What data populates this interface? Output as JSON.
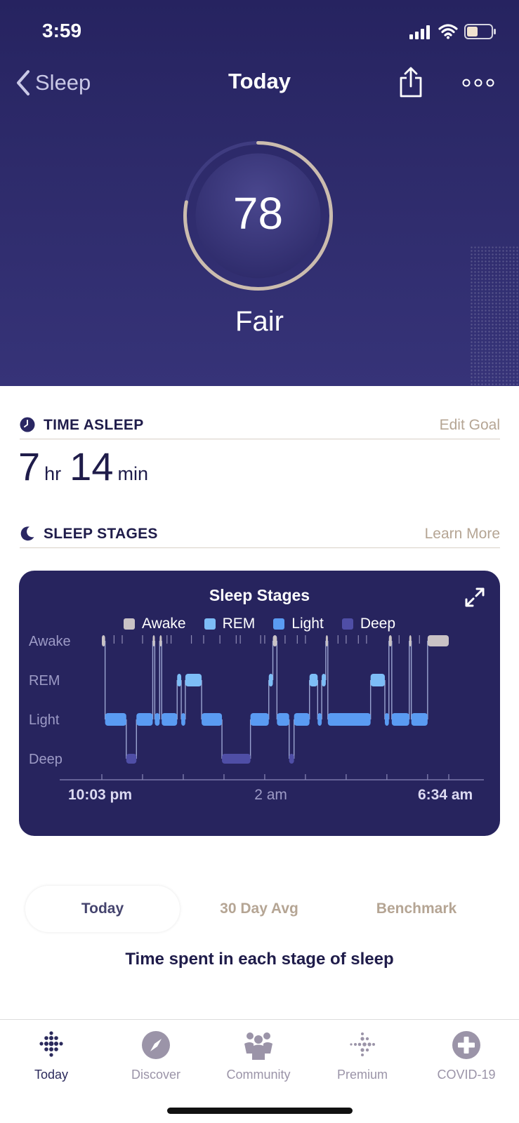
{
  "status": {
    "time": "3:59"
  },
  "nav": {
    "back_label": "Sleep",
    "title": "Today"
  },
  "score": {
    "value": "78",
    "label": "Fair",
    "fraction": 0.78
  },
  "time_asleep": {
    "title": "TIME ASLEEP",
    "edit_link": "Edit Goal",
    "hours": "7",
    "hours_unit": "hr",
    "minutes": "14",
    "minutes_unit": "min"
  },
  "sleep_stages": {
    "title": "SLEEP STAGES",
    "learn_link": "Learn More"
  },
  "chart_data": {
    "type": "area",
    "title": "Sleep Stages",
    "legend": [
      {
        "name": "Awake",
        "color": "#c9c2c5"
      },
      {
        "name": "REM",
        "color": "#7dbdf6"
      },
      {
        "name": "Light",
        "color": "#5a9bf2"
      },
      {
        "name": "Deep",
        "color": "#4f4ea6"
      }
    ],
    "y_categories": [
      "Awake",
      "REM",
      "Light",
      "Deep"
    ],
    "x_tick_labels": [
      "10:03 pm",
      "2 am",
      "6:34 am"
    ],
    "x_range": [
      "10:03 pm",
      "6:34 am"
    ],
    "stage_sequence": [
      {
        "stage": "Awake",
        "start_h": 0.0,
        "end_h": 0.08
      },
      {
        "stage": "Light",
        "start_h": 0.08,
        "end_h": 0.6
      },
      {
        "stage": "Deep",
        "start_h": 0.6,
        "end_h": 0.85
      },
      {
        "stage": "Light",
        "start_h": 0.85,
        "end_h": 1.25
      },
      {
        "stage": "Awake",
        "start_h": 1.25,
        "end_h": 1.3
      },
      {
        "stage": "Light",
        "start_h": 1.3,
        "end_h": 1.42
      },
      {
        "stage": "Awake",
        "start_h": 1.42,
        "end_h": 1.47
      },
      {
        "stage": "Light",
        "start_h": 1.47,
        "end_h": 1.85
      },
      {
        "stage": "REM",
        "start_h": 1.85,
        "end_h": 1.95
      },
      {
        "stage": "Light",
        "start_h": 1.95,
        "end_h": 2.05
      },
      {
        "stage": "REM",
        "start_h": 2.05,
        "end_h": 2.45
      },
      {
        "stage": "Light",
        "start_h": 2.45,
        "end_h": 2.95
      },
      {
        "stage": "Deep",
        "start_h": 2.95,
        "end_h": 3.65
      },
      {
        "stage": "Light",
        "start_h": 3.65,
        "end_h": 4.1
      },
      {
        "stage": "REM",
        "start_h": 4.1,
        "end_h": 4.2
      },
      {
        "stage": "Awake",
        "start_h": 4.2,
        "end_h": 4.3
      },
      {
        "stage": "Light",
        "start_h": 4.3,
        "end_h": 4.6
      },
      {
        "stage": "Deep",
        "start_h": 4.6,
        "end_h": 4.72
      },
      {
        "stage": "Light",
        "start_h": 4.72,
        "end_h": 5.1
      },
      {
        "stage": "REM",
        "start_h": 5.1,
        "end_h": 5.3
      },
      {
        "stage": "Light",
        "start_h": 5.3,
        "end_h": 5.4
      },
      {
        "stage": "REM",
        "start_h": 5.4,
        "end_h": 5.5
      },
      {
        "stage": "Awake",
        "start_h": 5.5,
        "end_h": 5.55
      },
      {
        "stage": "Light",
        "start_h": 5.55,
        "end_h": 6.6
      },
      {
        "stage": "REM",
        "start_h": 6.6,
        "end_h": 6.95
      },
      {
        "stage": "Light",
        "start_h": 6.95,
        "end_h": 7.05
      },
      {
        "stage": "Awake",
        "start_h": 7.05,
        "end_h": 7.12
      },
      {
        "stage": "Light",
        "start_h": 7.12,
        "end_h": 7.55
      },
      {
        "stage": "Awake",
        "start_h": 7.55,
        "end_h": 7.6
      },
      {
        "stage": "Light",
        "start_h": 7.6,
        "end_h": 8.0
      },
      {
        "stage": "Awake",
        "start_h": 8.0,
        "end_h": 8.52
      }
    ]
  },
  "tabs": {
    "items": [
      "Today",
      "30 Day Avg",
      "Benchmark"
    ],
    "active": 0
  },
  "tabs_caption": "Time spent in each stage of sleep",
  "tabbar": {
    "items": [
      {
        "label": "Today",
        "icon": "fitbit-dots-icon"
      },
      {
        "label": "Discover",
        "icon": "compass-icon"
      },
      {
        "label": "Community",
        "icon": "community-icon"
      },
      {
        "label": "Premium",
        "icon": "premium-dots-icon"
      },
      {
        "label": "COVID-19",
        "icon": "plus-cross-icon"
      }
    ]
  },
  "colors": {
    "header": "#2c2968",
    "accent_link": "#b5a594",
    "score_ring": "#cbbcae"
  }
}
